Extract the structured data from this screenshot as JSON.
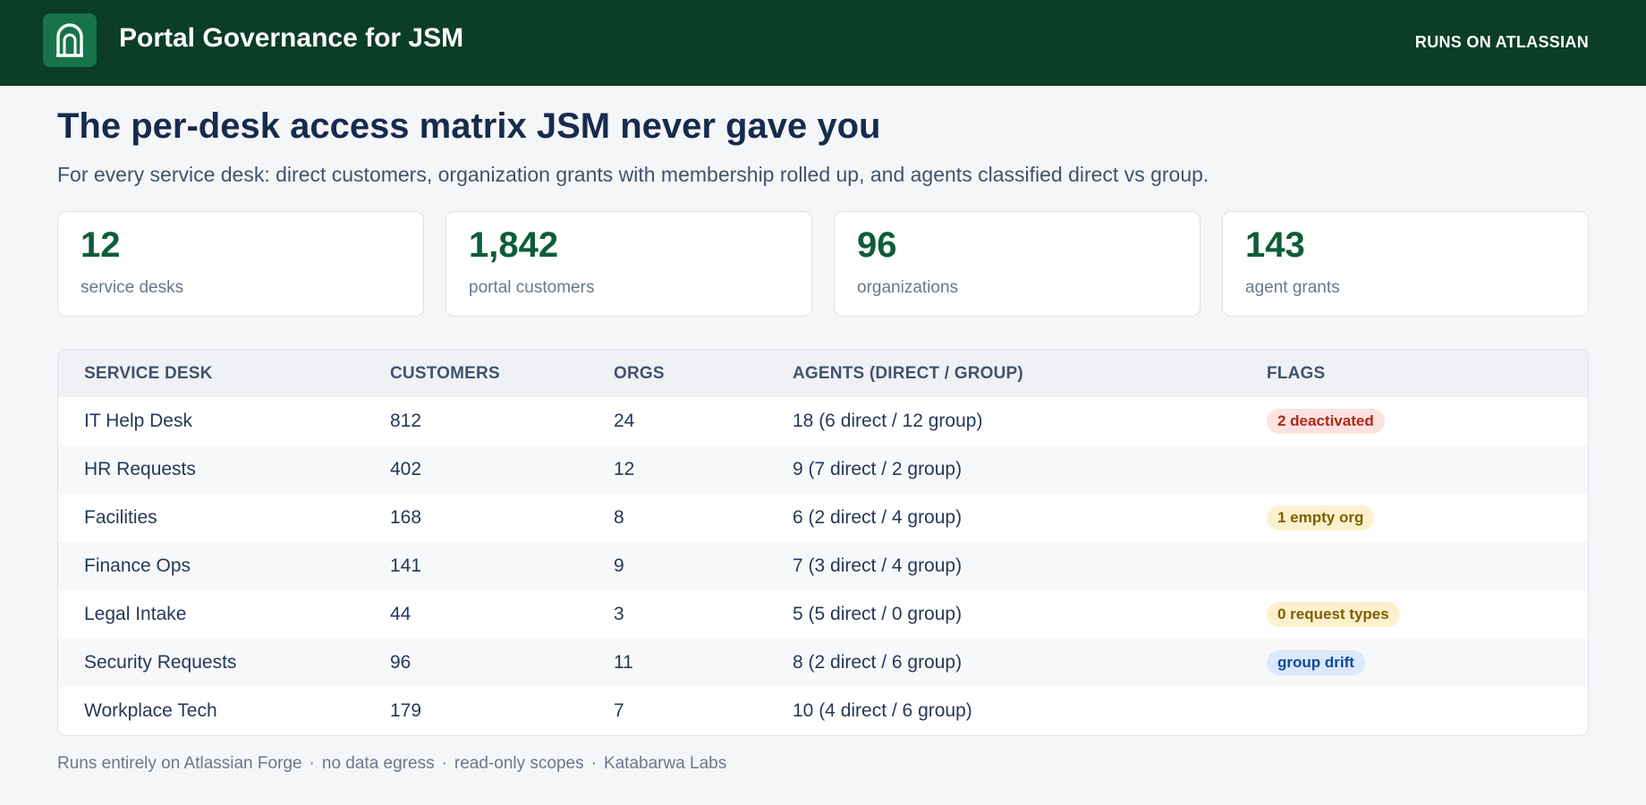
{
  "header": {
    "app_title": "Portal Governance for JSM",
    "runs_on": "RUNS ON ATLASSIAN",
    "logo_icon": "portal-arch-icon",
    "bg_color": "#0b3d28",
    "logo_color": "#17734a"
  },
  "hero": {
    "title": "The per-desk access matrix JSM never gave you",
    "subtitle": "For every service desk: direct customers, organization grants with membership rolled up, and agents classified direct vs group."
  },
  "stats": [
    {
      "value": "12",
      "label": "service desks"
    },
    {
      "value": "1,842",
      "label": "portal customers"
    },
    {
      "value": "96",
      "label": "organizations"
    },
    {
      "value": "143",
      "label": "agent grants"
    }
  ],
  "table": {
    "columns": [
      "SERVICE DESK",
      "CUSTOMERS",
      "ORGS",
      "AGENTS (DIRECT / GROUP)",
      "FLAGS"
    ],
    "rows": [
      {
        "desk": "IT Help Desk",
        "customers": "812",
        "orgs": "24",
        "agents": "18  (6 direct / 12 group)",
        "flag": "2 deactivated",
        "flag_color": "red"
      },
      {
        "desk": "HR Requests",
        "customers": "402",
        "orgs": "12",
        "agents": "9  (7 direct / 2 group)",
        "flag": "",
        "flag_color": ""
      },
      {
        "desk": "Facilities",
        "customers": "168",
        "orgs": "8",
        "agents": "6  (2 direct / 4 group)",
        "flag": "1 empty org",
        "flag_color": "amber"
      },
      {
        "desk": "Finance Ops",
        "customers": "141",
        "orgs": "9",
        "agents": "7  (3 direct / 4 group)",
        "flag": "",
        "flag_color": ""
      },
      {
        "desk": "Legal Intake",
        "customers": "44",
        "orgs": "3",
        "agents": "5  (5 direct / 0 group)",
        "flag": "0 request types",
        "flag_color": "amber"
      },
      {
        "desk": "Security Requests",
        "customers": "96",
        "orgs": "11",
        "agents": "8  (2 direct / 6 group)",
        "flag": "group drift",
        "flag_color": "blue"
      },
      {
        "desk": "Workplace Tech",
        "customers": "179",
        "orgs": "7",
        "agents": "10  (4 direct / 6 group)",
        "flag": "",
        "flag_color": ""
      }
    ]
  },
  "footer": {
    "items": [
      "Runs entirely on Atlassian Forge",
      "no data egress",
      "read-only scopes",
      "Katabarwa Labs"
    ],
    "separator": "·"
  }
}
